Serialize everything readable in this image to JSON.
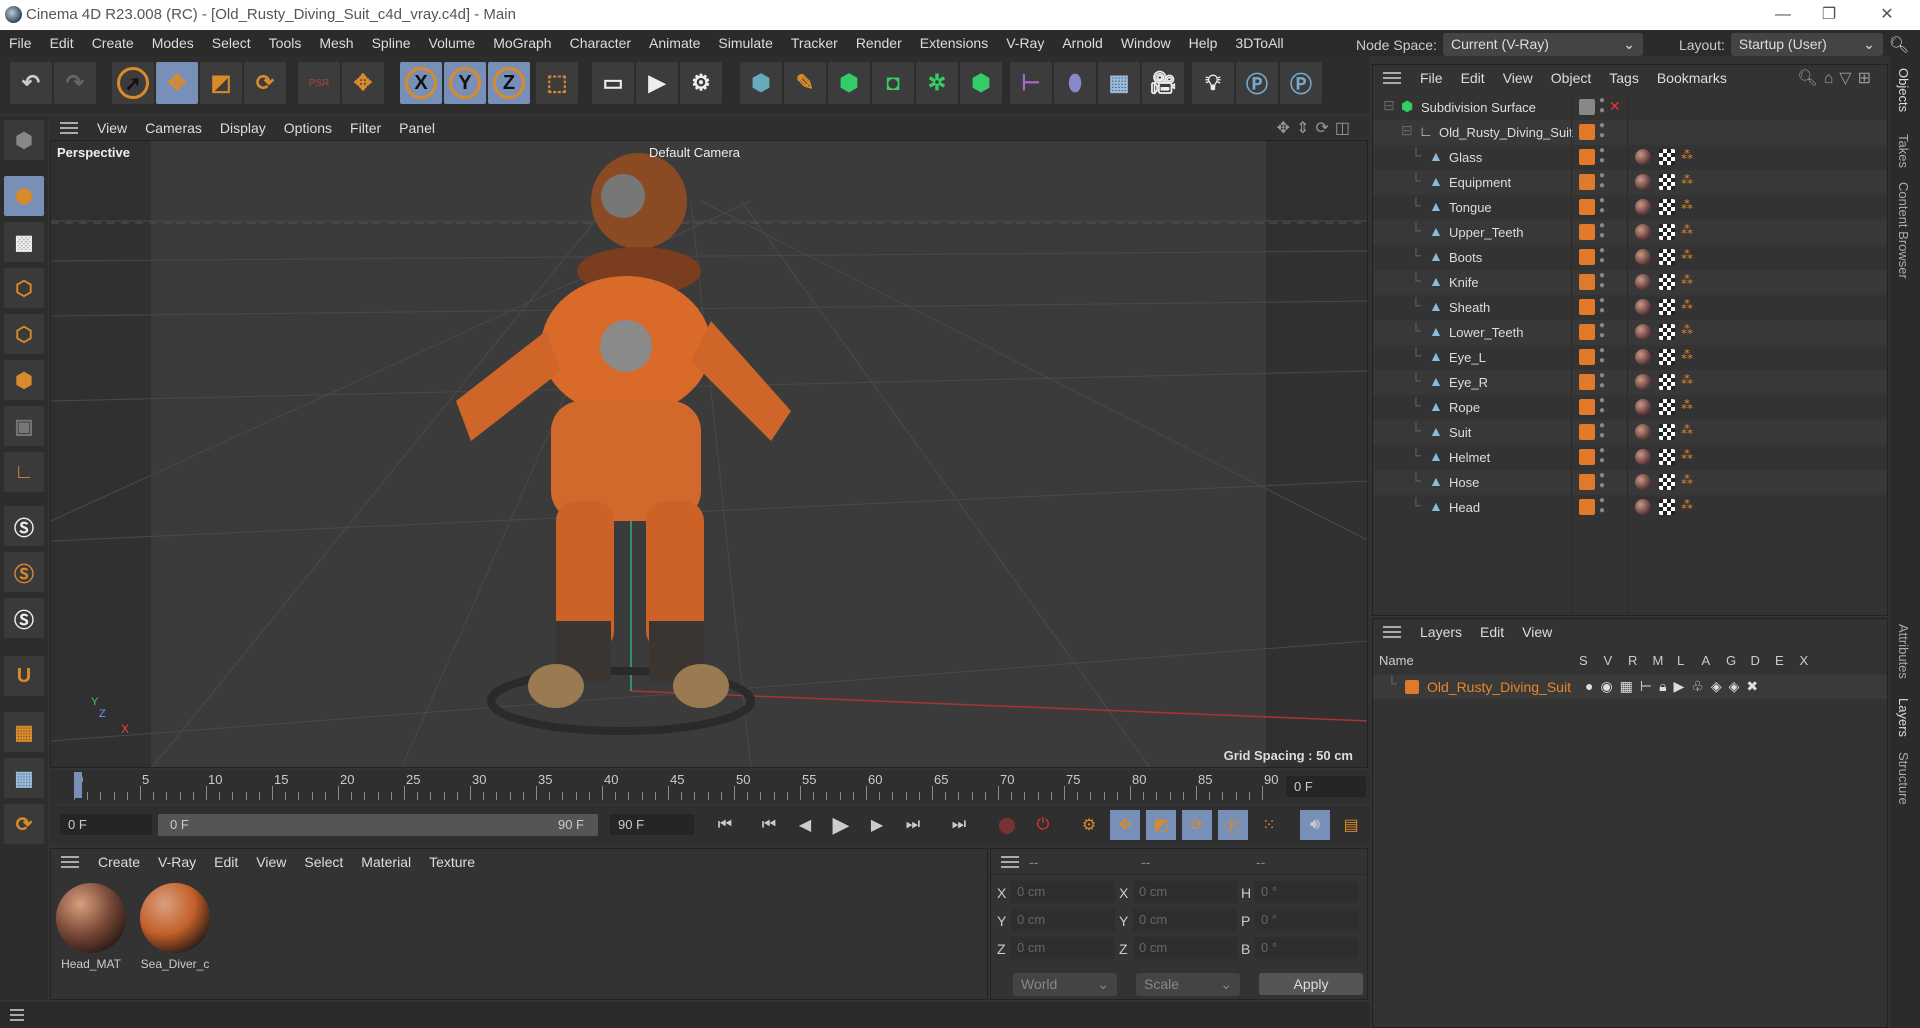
{
  "window": {
    "title": "Cinema 4D R23.008 (RC) - [Old_Rusty_Diving_Suit_c4d_vray.c4d] - Main",
    "minimize": "—",
    "restore": "❐",
    "close": "✕"
  },
  "menu": [
    "File",
    "Edit",
    "Create",
    "Modes",
    "Select",
    "Tools",
    "Mesh",
    "Spline",
    "Volume",
    "MoGraph",
    "Character",
    "Animate",
    "Simulate",
    "Tracker",
    "Render",
    "Extensions",
    "V-Ray",
    "Arnold",
    "Window",
    "Help",
    "3DToAll"
  ],
  "node_space": {
    "label": "Node Space:",
    "value": "Current (V-Ray)"
  },
  "layout": {
    "label": "Layout:",
    "value": "Startup (User)"
  },
  "toolbar": {
    "x": "X",
    "y": "Y",
    "z": "Z",
    "psr": "PSR"
  },
  "viewport": {
    "menu": [
      "View",
      "Cameras",
      "Display",
      "Options",
      "Filter",
      "Panel"
    ],
    "label": "Perspective",
    "camera": "Default Camera",
    "grid_spacing": "Grid Spacing : 50 cm",
    "axis_x": "X",
    "axis_y": "Y",
    "axis_z": "Z"
  },
  "timeline": {
    "ticks": [
      "0",
      "5",
      "10",
      "15",
      "20",
      "25",
      "30",
      "35",
      "40",
      "45",
      "50",
      "55",
      "60",
      "65",
      "70",
      "75",
      "80",
      "85",
      "90"
    ],
    "current_frame": "0 F"
  },
  "transport": {
    "start": "0 F",
    "range_start": "0 F",
    "range_end": "90 F",
    "end": "90 F"
  },
  "material_panel": {
    "menu": [
      "Create",
      "V-Ray",
      "Edit",
      "View",
      "Select",
      "Material",
      "Texture"
    ],
    "materials": [
      "Head_MAT",
      "Sea_Diver_c"
    ]
  },
  "coordinates": {
    "headers": [
      "--",
      "--",
      "--"
    ],
    "rows": [
      {
        "a": "X",
        "av": "0 cm",
        "b": "X",
        "bv": "0 cm",
        "c": "H",
        "cv": "0 °"
      },
      {
        "a": "Y",
        "av": "0 cm",
        "b": "Y",
        "bv": "0 cm",
        "c": "P",
        "cv": "0 °"
      },
      {
        "a": "Z",
        "av": "0 cm",
        "b": "Z",
        "bv": "0 cm",
        "c": "B",
        "cv": "0 °"
      }
    ],
    "space": "World",
    "mode": "Scale",
    "apply": "Apply"
  },
  "objects": {
    "menu": [
      "File",
      "Edit",
      "View",
      "Object",
      "Tags",
      "Bookmarks"
    ],
    "root": "Subdivision Surface",
    "group": "Old_Rusty_Diving_Suit",
    "children": [
      "Glass",
      "Equipment",
      "Tongue",
      "Upper_Teeth",
      "Boots",
      "Knife",
      "Sheath",
      "Lower_Teeth",
      "Eye_L",
      "Eye_R",
      "Rope",
      "Suit",
      "Helmet",
      "Hose",
      "Head"
    ]
  },
  "layers": {
    "menu": [
      "Layers",
      "Edit",
      "View"
    ],
    "columns": [
      "Name",
      "S",
      "V",
      "R",
      "M",
      "L",
      "A",
      "G",
      "D",
      "E",
      "X"
    ],
    "rows": [
      {
        "name": "Old_Rusty_Diving_Suit"
      }
    ]
  },
  "right_tabs": [
    "Objects",
    "Takes",
    "Content Browser",
    "Attributes",
    "Layers",
    "Structure"
  ],
  "colors": {
    "accent": "#d98a2a",
    "selected": "#7890b8",
    "layer": "#e07a2a"
  }
}
